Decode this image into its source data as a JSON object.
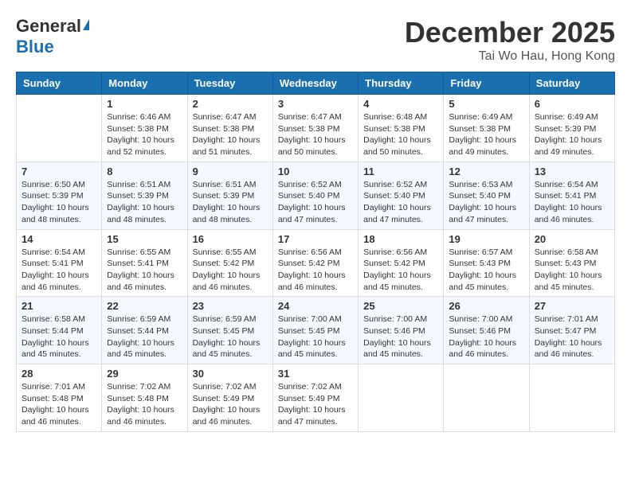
{
  "header": {
    "logo_general": "General",
    "logo_blue": "Blue",
    "month_title": "December 2025",
    "location": "Tai Wo Hau, Hong Kong"
  },
  "days_of_week": [
    "Sunday",
    "Monday",
    "Tuesday",
    "Wednesday",
    "Thursday",
    "Friday",
    "Saturday"
  ],
  "weeks": [
    [
      {
        "day": "",
        "info": ""
      },
      {
        "day": "1",
        "info": "Sunrise: 6:46 AM\nSunset: 5:38 PM\nDaylight: 10 hours\nand 52 minutes."
      },
      {
        "day": "2",
        "info": "Sunrise: 6:47 AM\nSunset: 5:38 PM\nDaylight: 10 hours\nand 51 minutes."
      },
      {
        "day": "3",
        "info": "Sunrise: 6:47 AM\nSunset: 5:38 PM\nDaylight: 10 hours\nand 50 minutes."
      },
      {
        "day": "4",
        "info": "Sunrise: 6:48 AM\nSunset: 5:38 PM\nDaylight: 10 hours\nand 50 minutes."
      },
      {
        "day": "5",
        "info": "Sunrise: 6:49 AM\nSunset: 5:38 PM\nDaylight: 10 hours\nand 49 minutes."
      },
      {
        "day": "6",
        "info": "Sunrise: 6:49 AM\nSunset: 5:39 PM\nDaylight: 10 hours\nand 49 minutes."
      }
    ],
    [
      {
        "day": "7",
        "info": "Sunrise: 6:50 AM\nSunset: 5:39 PM\nDaylight: 10 hours\nand 48 minutes."
      },
      {
        "day": "8",
        "info": "Sunrise: 6:51 AM\nSunset: 5:39 PM\nDaylight: 10 hours\nand 48 minutes."
      },
      {
        "day": "9",
        "info": "Sunrise: 6:51 AM\nSunset: 5:39 PM\nDaylight: 10 hours\nand 48 minutes."
      },
      {
        "day": "10",
        "info": "Sunrise: 6:52 AM\nSunset: 5:40 PM\nDaylight: 10 hours\nand 47 minutes."
      },
      {
        "day": "11",
        "info": "Sunrise: 6:52 AM\nSunset: 5:40 PM\nDaylight: 10 hours\nand 47 minutes."
      },
      {
        "day": "12",
        "info": "Sunrise: 6:53 AM\nSunset: 5:40 PM\nDaylight: 10 hours\nand 47 minutes."
      },
      {
        "day": "13",
        "info": "Sunrise: 6:54 AM\nSunset: 5:41 PM\nDaylight: 10 hours\nand 46 minutes."
      }
    ],
    [
      {
        "day": "14",
        "info": "Sunrise: 6:54 AM\nSunset: 5:41 PM\nDaylight: 10 hours\nand 46 minutes."
      },
      {
        "day": "15",
        "info": "Sunrise: 6:55 AM\nSunset: 5:41 PM\nDaylight: 10 hours\nand 46 minutes."
      },
      {
        "day": "16",
        "info": "Sunrise: 6:55 AM\nSunset: 5:42 PM\nDaylight: 10 hours\nand 46 minutes."
      },
      {
        "day": "17",
        "info": "Sunrise: 6:56 AM\nSunset: 5:42 PM\nDaylight: 10 hours\nand 46 minutes."
      },
      {
        "day": "18",
        "info": "Sunrise: 6:56 AM\nSunset: 5:42 PM\nDaylight: 10 hours\nand 45 minutes."
      },
      {
        "day": "19",
        "info": "Sunrise: 6:57 AM\nSunset: 5:43 PM\nDaylight: 10 hours\nand 45 minutes."
      },
      {
        "day": "20",
        "info": "Sunrise: 6:58 AM\nSunset: 5:43 PM\nDaylight: 10 hours\nand 45 minutes."
      }
    ],
    [
      {
        "day": "21",
        "info": "Sunrise: 6:58 AM\nSunset: 5:44 PM\nDaylight: 10 hours\nand 45 minutes."
      },
      {
        "day": "22",
        "info": "Sunrise: 6:59 AM\nSunset: 5:44 PM\nDaylight: 10 hours\nand 45 minutes."
      },
      {
        "day": "23",
        "info": "Sunrise: 6:59 AM\nSunset: 5:45 PM\nDaylight: 10 hours\nand 45 minutes."
      },
      {
        "day": "24",
        "info": "Sunrise: 7:00 AM\nSunset: 5:45 PM\nDaylight: 10 hours\nand 45 minutes."
      },
      {
        "day": "25",
        "info": "Sunrise: 7:00 AM\nSunset: 5:46 PM\nDaylight: 10 hours\nand 45 minutes."
      },
      {
        "day": "26",
        "info": "Sunrise: 7:00 AM\nSunset: 5:46 PM\nDaylight: 10 hours\nand 46 minutes."
      },
      {
        "day": "27",
        "info": "Sunrise: 7:01 AM\nSunset: 5:47 PM\nDaylight: 10 hours\nand 46 minutes."
      }
    ],
    [
      {
        "day": "28",
        "info": "Sunrise: 7:01 AM\nSunset: 5:48 PM\nDaylight: 10 hours\nand 46 minutes."
      },
      {
        "day": "29",
        "info": "Sunrise: 7:02 AM\nSunset: 5:48 PM\nDaylight: 10 hours\nand 46 minutes."
      },
      {
        "day": "30",
        "info": "Sunrise: 7:02 AM\nSunset: 5:49 PM\nDaylight: 10 hours\nand 46 minutes."
      },
      {
        "day": "31",
        "info": "Sunrise: 7:02 AM\nSunset: 5:49 PM\nDaylight: 10 hours\nand 47 minutes."
      },
      {
        "day": "",
        "info": ""
      },
      {
        "day": "",
        "info": ""
      },
      {
        "day": "",
        "info": ""
      }
    ]
  ]
}
